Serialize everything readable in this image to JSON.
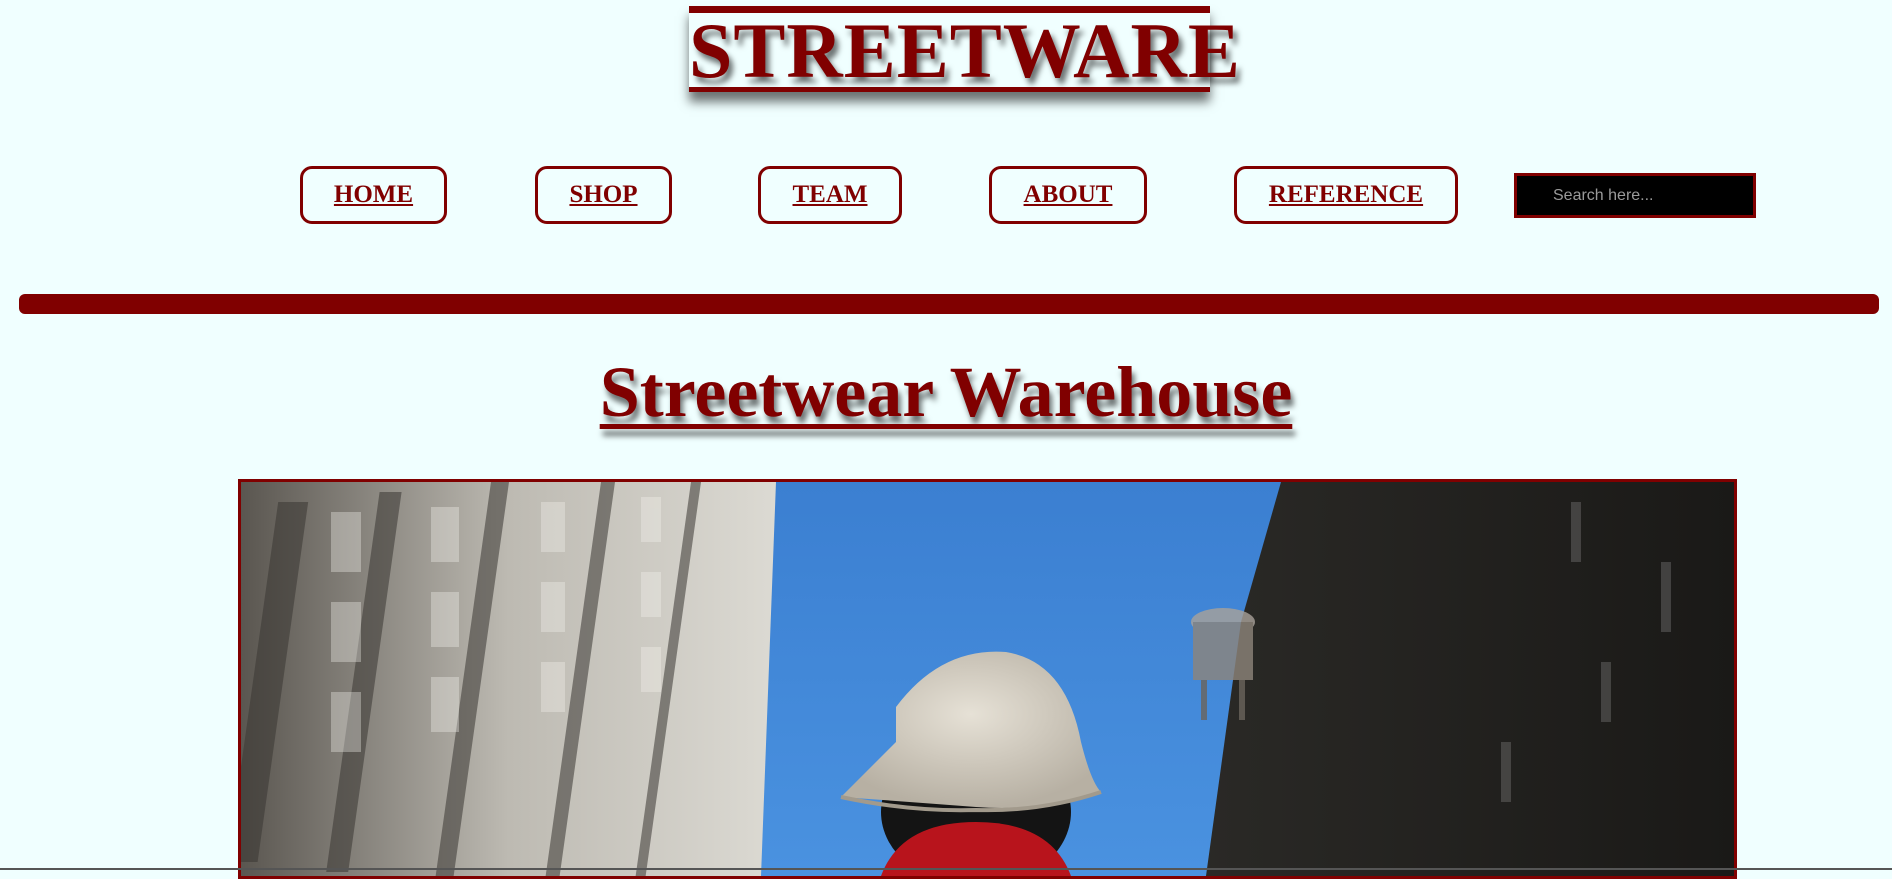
{
  "header": {
    "logo": "STREETWARE"
  },
  "nav": {
    "items": [
      {
        "label": "HOME"
      },
      {
        "label": "SHOP"
      },
      {
        "label": "TEAM"
      },
      {
        "label": "ABOUT"
      },
      {
        "label": "REFERENCE"
      }
    ]
  },
  "search": {
    "placeholder": "Search here..."
  },
  "main": {
    "headline": "Streetwear Warehouse"
  },
  "colors": {
    "brand": "#800000",
    "background": "#f0ffff",
    "search_bg": "#000000"
  }
}
